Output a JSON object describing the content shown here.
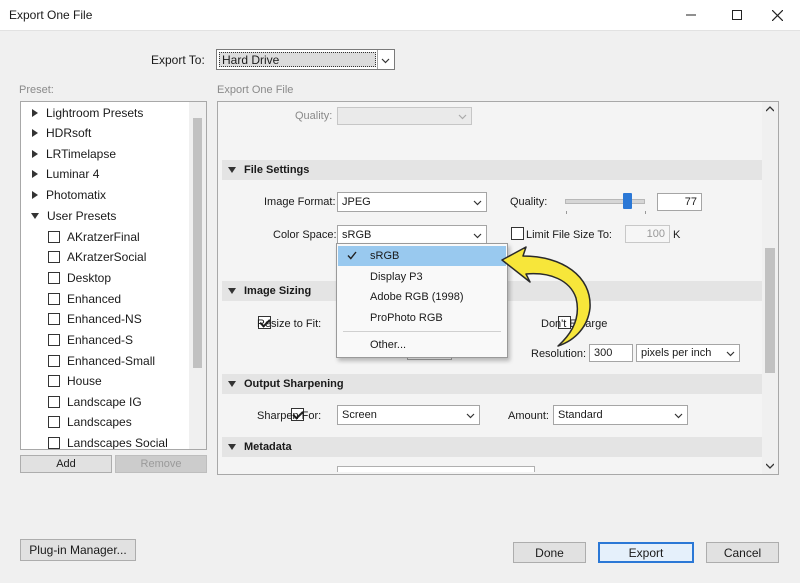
{
  "window": {
    "title": "Export One File"
  },
  "export_to": {
    "label": "Export To:",
    "value": "Hard Drive"
  },
  "preset": {
    "header": "Preset:",
    "groups": [
      {
        "label": "Lightroom Presets"
      },
      {
        "label": "HDRsoft"
      },
      {
        "label": "LRTimelapse"
      },
      {
        "label": "Luminar 4"
      },
      {
        "label": "Photomatix"
      },
      {
        "label": "User Presets"
      }
    ],
    "user_presets": [
      "AKratzerFinal",
      "AKratzerSocial",
      "Desktop",
      "Enhanced",
      "Enhanced-NS",
      "Enhanced-S",
      "Enhanced-Small",
      "House",
      "Landscape IG",
      "Landscapes",
      "Landscapes Social"
    ],
    "add_label": "Add",
    "remove_label": "Remove"
  },
  "panel_header": "Export One File",
  "top": {
    "quality_label": "Quality:"
  },
  "file_settings": {
    "header": "File Settings",
    "image_format_label": "Image Format:",
    "image_format_value": "JPEG",
    "quality_label": "Quality:",
    "quality_value": "77",
    "quality_fraction": 0.77,
    "color_space_label": "Color Space:",
    "color_space_value": "sRGB",
    "limit_label": "Limit File Size To:",
    "limit_value": "100",
    "limit_unit": "K"
  },
  "color_menu": {
    "items": [
      "sRGB",
      "Display P3",
      "Adobe RGB (1998)",
      "ProPhoto RGB"
    ],
    "other": "Other...",
    "selected": "sRGB"
  },
  "image_sizing": {
    "header": "Image Sizing",
    "resize_label": "Resize to Fit:",
    "dont_enlarge_label": "Don't Enlarge",
    "resolution_label": "Resolution:",
    "resolution_value": "300",
    "resolution_unit": "pixels per inch"
  },
  "output_sharpening": {
    "header": "Output Sharpening",
    "sharpen_label": "Sharpen For:",
    "sharpen_value": "Screen",
    "amount_label": "Amount:",
    "amount_value": "Standard"
  },
  "metadata": {
    "header": "Metadata"
  },
  "buttons": {
    "plugin_manager": "Plug-in Manager...",
    "done": "Done",
    "export": "Export",
    "cancel": "Cancel"
  },
  "colors": {
    "accent": "#2b78d6",
    "highlight": "#99c9ef",
    "arrow": "#f7e63a"
  }
}
